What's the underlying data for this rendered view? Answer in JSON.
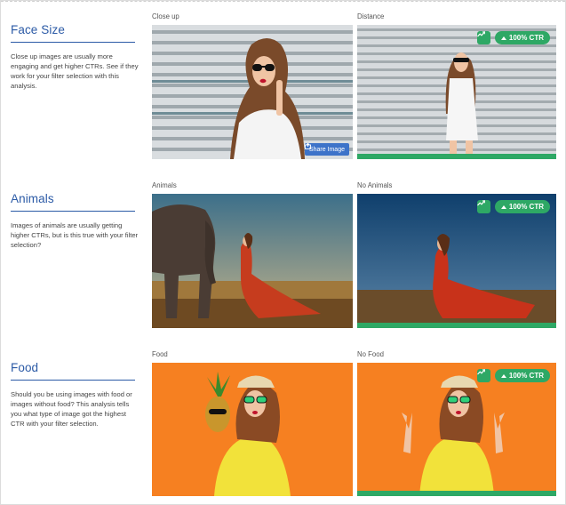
{
  "sections": [
    {
      "title": "Face Size",
      "description": "Close up images are usually more engaging and get higher CTRs. See if they work for your filter selection with this analysis.",
      "left_caption": "Close up",
      "right_caption": "Distance"
    },
    {
      "title": "Animals",
      "description": "Images of animals are usually getting higher CTRs, but is this true with your filter selection?",
      "left_caption": "Animals",
      "right_caption": "No Animals"
    },
    {
      "title": "Food",
      "description": "Should you be using images with food or images without food? This analysis tells you what type of image got the highest CTR with your filter selection.",
      "left_caption": "Food",
      "right_caption": "No Food"
    }
  ],
  "badge": {
    "ctr_label": "100% CTR",
    "icon": "trending-up-icon"
  },
  "share_button": {
    "label": "Share Image",
    "icon": "share-icon"
  },
  "colors": {
    "heading": "#2b5aa6",
    "accent_green": "#2ea865",
    "share_blue": "#3d73c9"
  }
}
